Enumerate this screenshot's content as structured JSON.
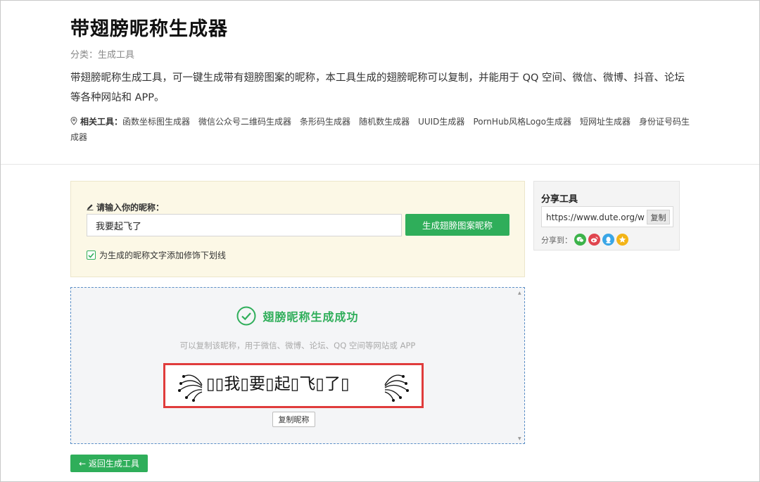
{
  "header": {
    "title": "带翅膀昵称生成器",
    "category": "分类：生成工具",
    "description": "带翅膀昵称生成工具，可一键生成带有翅膀图案的昵称，本工具生成的翅膀昵称可以复制，并能用于 QQ 空间、微信、微博、抖音、论坛等各种网站和 APP。",
    "related_label": "相关工具：",
    "related_tools": [
      "函数坐标图生成器",
      "微信公众号二维码生成器",
      "条形码生成器",
      "随机数生成器",
      "UUID生成器",
      "PornHub风格Logo生成器",
      "短网址生成器",
      "身份证号码生成器"
    ]
  },
  "form": {
    "label": "请输入你的昵称：",
    "input_value": "我要起飞了",
    "generate_button": "生成翅膀图案昵称",
    "underline_option": "为生成的昵称文字添加修饰下划线",
    "underline_checked": true
  },
  "result": {
    "title": "翅膀昵称生成成功",
    "subtitle": "可以复制该昵称，用于微信、微博、论坛、QQ 空间等网站或 APP",
    "nickname": "▯▯我▯要▯起▯飞▯了▯",
    "copy_button": "复制昵称"
  },
  "back_button": "← 返回生成工具",
  "share": {
    "title": "分享工具",
    "url": "https://www.dute.org/wings-nickname",
    "copy_button": "复制",
    "share_to": "分享到：",
    "targets": [
      "wechat-icon",
      "weibo-icon",
      "qq-icon",
      "qzone-icon"
    ]
  },
  "colors": {
    "accent": "#2fae5a",
    "input_panel_bg": "#fcf8e6",
    "result_border": "#e03c3c"
  }
}
